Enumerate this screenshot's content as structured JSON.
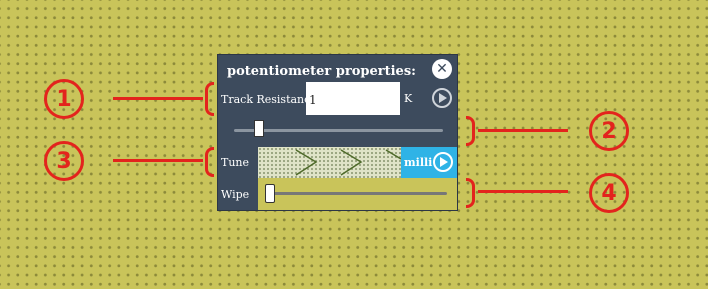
{
  "panel": {
    "title": "potentiometer properties:",
    "close_icon": "close-icon"
  },
  "track_resistance": {
    "label": "Track Resistance",
    "value": "1",
    "unit": "K"
  },
  "resistance_slider": {
    "level_fraction": 0.07
  },
  "tune": {
    "label": "Tune",
    "unit": "milli"
  },
  "wipe": {
    "label": "Wipe",
    "level_fraction": 0.0
  },
  "callouts": [
    "1",
    "2",
    "3",
    "4"
  ],
  "colors": {
    "background": "#c9c45a",
    "panel": "#3d4b5d",
    "accent": "#2fb3e6",
    "callout": "#e3241d"
  }
}
